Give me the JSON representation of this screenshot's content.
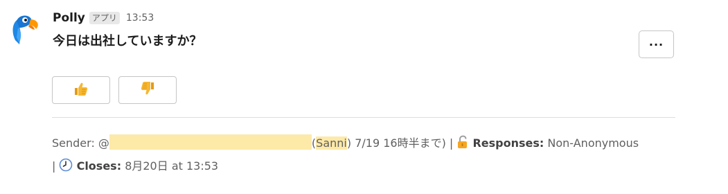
{
  "message": {
    "sender_name": "Polly",
    "app_badge": "アプリ",
    "timestamp": "13:53",
    "question": "今日は出社していますか？",
    "more_actions_label": "···"
  },
  "buttons": {
    "thumbs_up": "thumbs-up-icon",
    "thumbs_down": "thumbs-down-icon"
  },
  "context": {
    "sender_label": "Sender: @",
    "mention_highlight": "Sanni",
    "sender_status_prefix": "(",
    "sender_status_suffix": ") 7/19 16時半まで) |",
    "lock_icon": "unlock-icon",
    "responses_label": "Responses:",
    "responses_value": "Non-Anonymous",
    "separator": "|",
    "clock_icon": "clock-icon",
    "closes_label": "Closes:",
    "closes_value": "8月20日 at 13:53"
  },
  "colors": {
    "accent_yellow_highlight": "#fde9a8",
    "muted_text": "#616061",
    "border": "#c5c5c5"
  }
}
